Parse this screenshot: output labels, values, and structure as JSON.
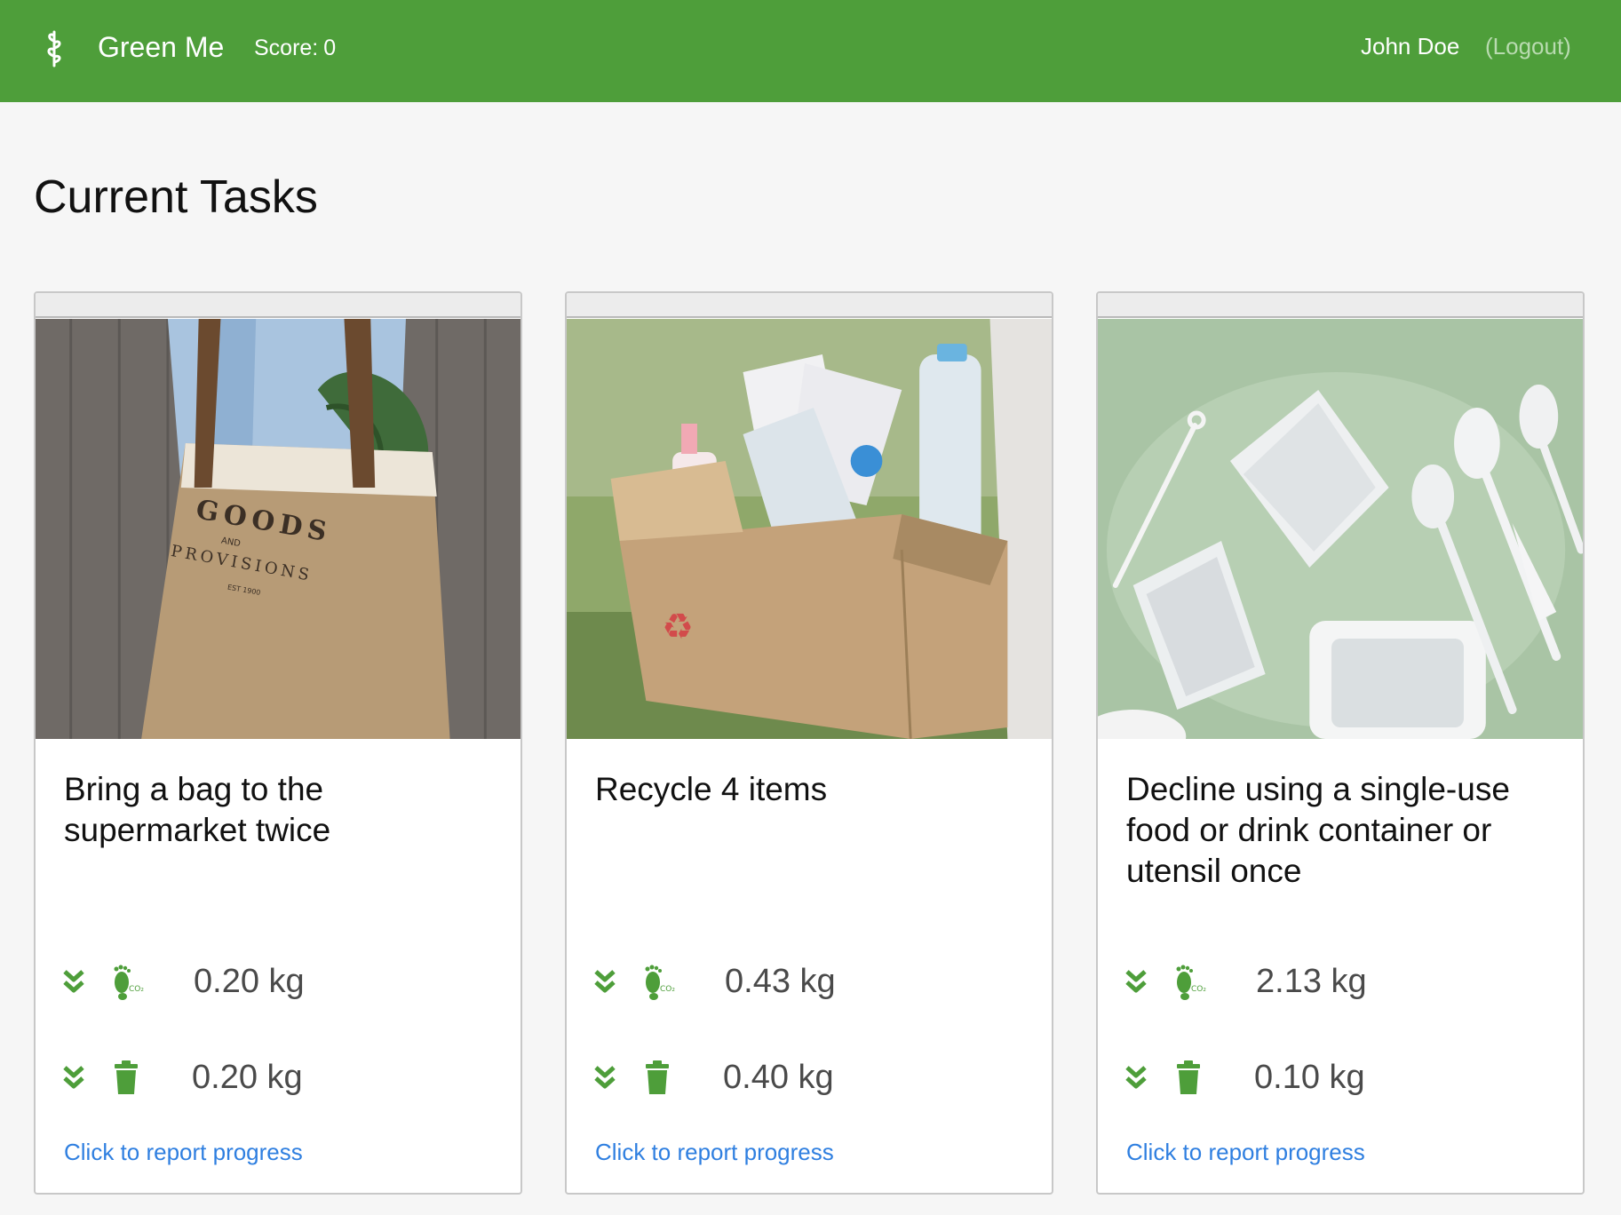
{
  "header": {
    "brand": "Green Me",
    "score_label": "Score:",
    "score_value": "0",
    "user_name": "John Doe",
    "logout_label": "(Logout)"
  },
  "page": {
    "title": "Current Tasks"
  },
  "colors": {
    "brand_green": "#4e9e3a",
    "icon_green": "#4e9e3a",
    "link_blue": "#2f7fe0"
  },
  "tasks": [
    {
      "title": "Bring a bag to the supermarket twice",
      "image": "tote-bag-photo",
      "co2_saving": "0.20 kg",
      "waste_saving": "0.20 kg",
      "link": "Click to report progress"
    },
    {
      "title": "Recycle 4 items",
      "image": "recycling-box-photo",
      "co2_saving": "0.43 kg",
      "waste_saving": "0.40 kg",
      "link": "Click to report progress"
    },
    {
      "title": "Decline using a single-use food or drink container or utensil once",
      "image": "plastic-utensils-photo",
      "co2_saving": "2.13 kg",
      "waste_saving": "0.10 kg",
      "link": "Click to report progress"
    }
  ],
  "icons": {
    "brand": "sprout-icon",
    "decrease": "double-chevron-down-icon",
    "co2": "co2-footprint-icon",
    "waste": "trash-icon"
  }
}
